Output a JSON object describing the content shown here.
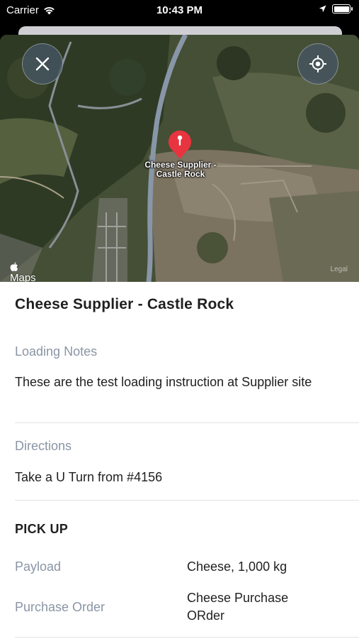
{
  "status_bar": {
    "carrier": "Carrier",
    "time": "10:43 PM"
  },
  "map": {
    "pin_label_line1": "Cheese Supplier -",
    "pin_label_line2": "Castle Rock",
    "maps_logo": "Maps",
    "legal": "Legal",
    "pin_color": "#e8343f"
  },
  "location": {
    "title": "Cheese Supplier - Castle Rock"
  },
  "loading_notes": {
    "label": "Loading Notes",
    "text": "These are the test loading instruction at Supplier site"
  },
  "directions": {
    "label": "Directions",
    "text": "Take a U Turn from #4156"
  },
  "pickup": {
    "heading": "PICK UP",
    "payload_label": "Payload",
    "payload_value": "Cheese, 1,000 kg",
    "po_label": "Purchase Order",
    "po_value": "Cheese Purchase ORder"
  }
}
